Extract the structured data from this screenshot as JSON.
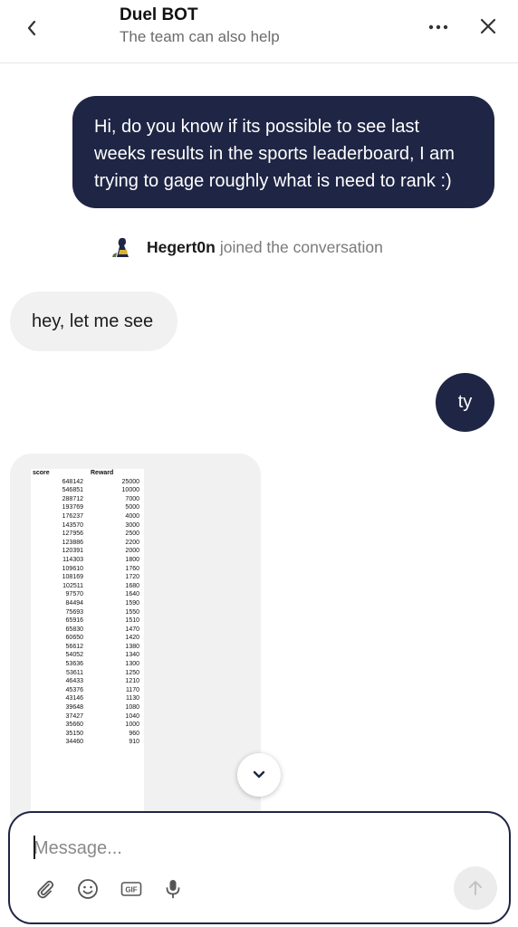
{
  "header": {
    "title": "Duel BOT",
    "subtitle": "The team can also help"
  },
  "messages": {
    "user_question": "Hi, do you know if its possible to see last weeks results in the sports leaderboard, I am trying to gage roughly what is need to rank :)",
    "join_name": "Hegert0n",
    "join_text": "joined the conversation",
    "agent_reply": "hey, let me see",
    "user_thanks": "ty"
  },
  "leaderboard_image": {
    "headers": [
      "score",
      "Reward"
    ],
    "rows": [
      [
        "648142",
        "25000"
      ],
      [
        "546851",
        "10000"
      ],
      [
        "288712",
        "7000"
      ],
      [
        "193769",
        "5000"
      ],
      [
        "176237",
        "4000"
      ],
      [
        "143570",
        "3000"
      ],
      [
        "127956",
        "2500"
      ],
      [
        "123886",
        "2200"
      ],
      [
        "120391",
        "2000"
      ],
      [
        "114303",
        "1800"
      ],
      [
        "109610",
        "1760"
      ],
      [
        "108169",
        "1720"
      ],
      [
        "102511",
        "1680"
      ],
      [
        "97570",
        "1640"
      ],
      [
        "84494",
        "1590"
      ],
      [
        "75693",
        "1550"
      ],
      [
        "65916",
        "1510"
      ],
      [
        "65830",
        "1470"
      ],
      [
        "60650",
        "1420"
      ],
      [
        "56612",
        "1380"
      ],
      [
        "54052",
        "1340"
      ],
      [
        "53636",
        "1300"
      ],
      [
        "53611",
        "1250"
      ],
      [
        "46433",
        "1210"
      ],
      [
        "45376",
        "1170"
      ],
      [
        "43146",
        "1130"
      ],
      [
        "39648",
        "1080"
      ],
      [
        "37427",
        "1040"
      ],
      [
        "35660",
        "1000"
      ],
      [
        "35150",
        "960"
      ],
      [
        "34460",
        "910"
      ]
    ]
  },
  "composer": {
    "placeholder": "Message..."
  },
  "colors": {
    "accent": "#1f2544",
    "bubble_incoming": "#f1f1f1",
    "send_disabled": "#ececec"
  },
  "icons": {
    "back": "chevron-left-icon",
    "more": "more-dots-icon",
    "close": "close-icon",
    "scroll": "chevron-down-icon",
    "attach": "paperclip-icon",
    "emoji": "smiley-icon",
    "gif": "gif-icon",
    "mic": "microphone-icon",
    "send": "arrow-up-icon"
  }
}
